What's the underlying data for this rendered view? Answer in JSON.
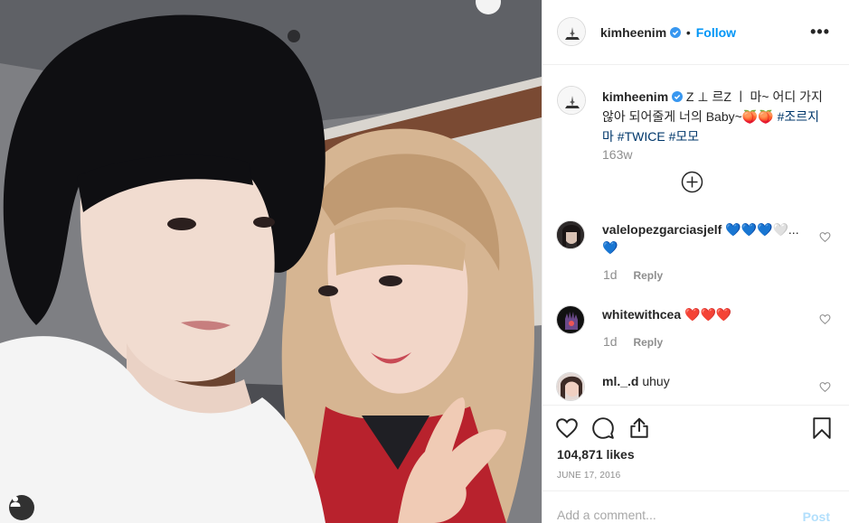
{
  "post": {
    "username": "kimheenim",
    "follow_label": "Follow",
    "separator": "•",
    "more_label": "•••",
    "caption_text": "Z ⊥ 르Z ㅣ 마~ 어디 가지 않아 되어줄게 너의 Baby~🍑🍑",
    "caption_tags": [
      "#조르지마",
      "#TWICE",
      "#모모"
    ],
    "caption_age": "163w",
    "likes": "104,871 likes",
    "date": "JUNE 17, 2016"
  },
  "comments": [
    {
      "username": "valelopezgarciasjelf",
      "text": "💙💙💙🤍",
      "hearts_line2": "💙",
      "age": "1d",
      "reply_label": "Reply"
    },
    {
      "username": "whitewithcea",
      "text": "❤️❤️❤️",
      "age": "1d",
      "reply_label": "Reply"
    },
    {
      "username": "ml._.d",
      "text": "uhuy"
    }
  ],
  "composer": {
    "placeholder": "Add a comment...",
    "post_label": "Post"
  },
  "icons": {
    "verified": "verified-badge-icon",
    "more": "more-options-icon",
    "load_more": "plus-circle-icon",
    "like": "heart-icon",
    "comment": "comment-bubble-icon",
    "share": "share-icon",
    "save": "bookmark-icon",
    "tag": "user-tag-icon"
  },
  "colors": {
    "accent": "#0095f6",
    "verified": "#3897f0",
    "secondary_text": "#8e8e8e",
    "border": "#efefef",
    "hashtag": "#00376b"
  }
}
